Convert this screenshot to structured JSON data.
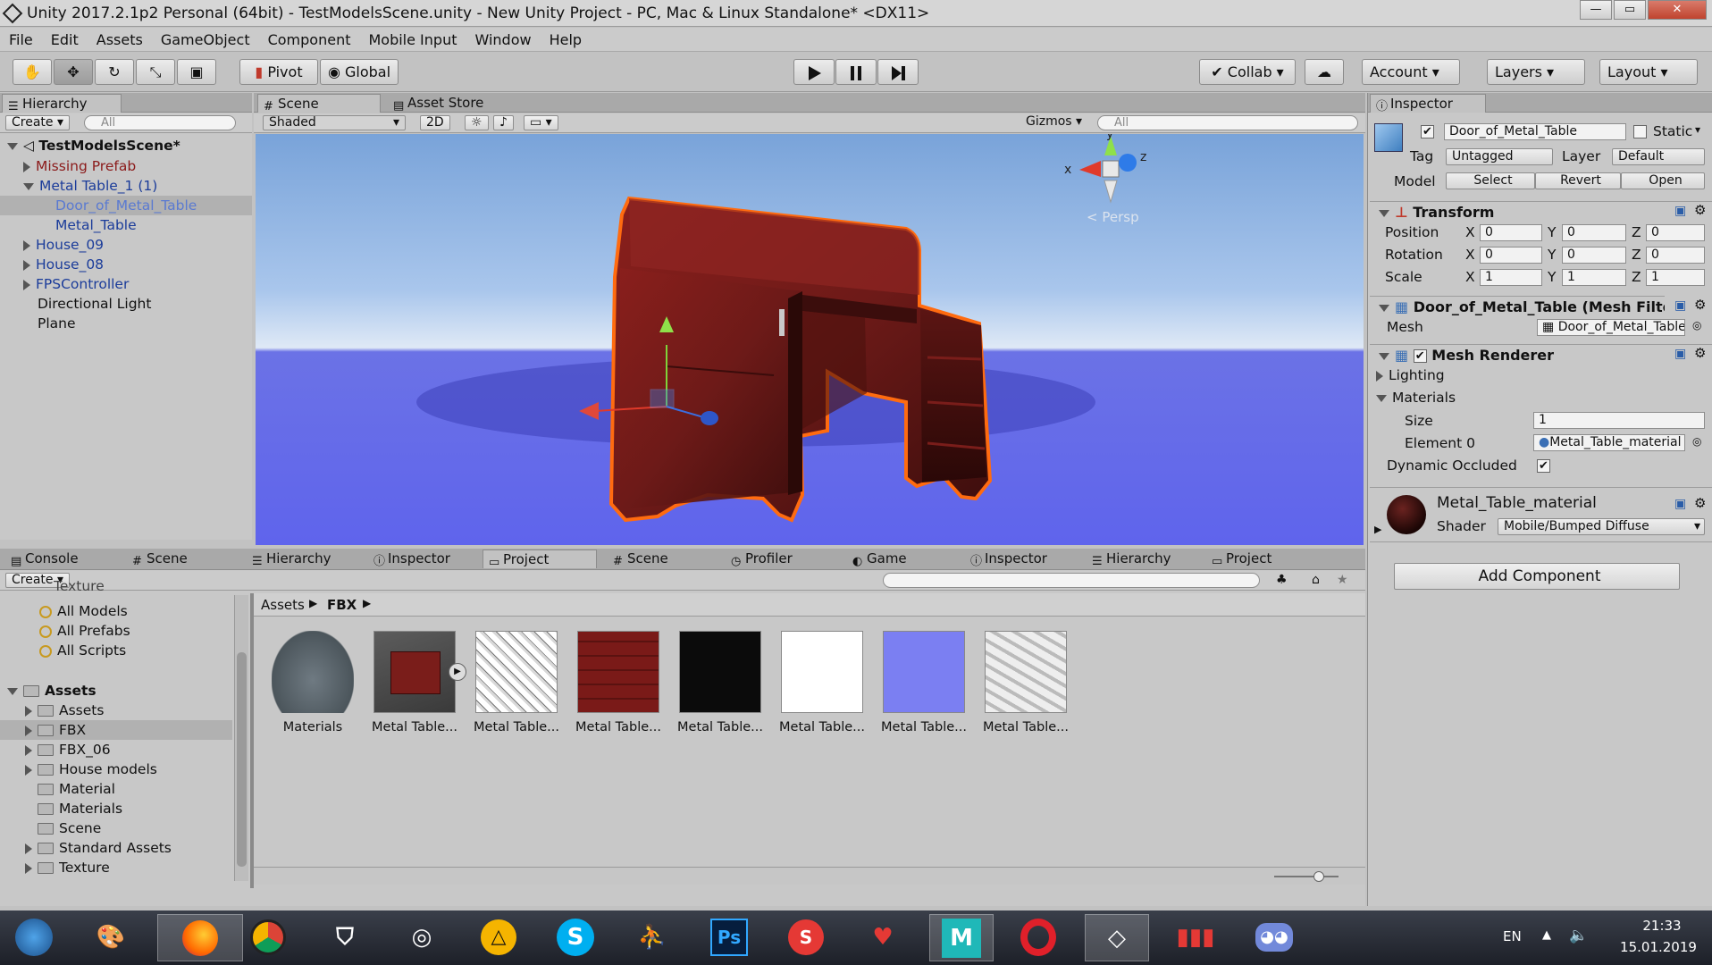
{
  "window": {
    "title": "Unity 2017.2.1p2 Personal (64bit) - TestModelsScene.unity - New Unity Project - PC, Mac & Linux Standalone* <DX11>",
    "minimize": "—",
    "maximize": "▭",
    "close": "✕"
  },
  "menu": [
    "File",
    "Edit",
    "Assets",
    "GameObject",
    "Component",
    "Mobile Input",
    "Window",
    "Help"
  ],
  "toolbar": {
    "pivot": "Pivot",
    "global": "Global",
    "collab": "Collab",
    "account": "Account",
    "layers": "Layers",
    "layout": "Layout"
  },
  "hierarchy": {
    "tab": "Hierarchy",
    "create": "Create",
    "search_placeholder": "All",
    "scene": "TestModelsScene*",
    "items": [
      {
        "label": "Missing Prefab",
        "color": "#8b1a1a"
      },
      {
        "label": "Metal Table_1 (1)",
        "color": "#1b3c9a"
      },
      {
        "label": "Door_of_Metal_Table",
        "color": "#5a7ad1"
      },
      {
        "label": "Metal_Table",
        "color": "#1b3c9a"
      },
      {
        "label": "House_09",
        "color": "#1b3c9a"
      },
      {
        "label": "House_08",
        "color": "#1b3c9a"
      },
      {
        "label": "FPSController",
        "color": "#1b3c9a"
      },
      {
        "label": "Directional Light",
        "color": "#111111"
      },
      {
        "label": "Plane",
        "color": "#111111"
      }
    ]
  },
  "scene": {
    "tab_scene": "Scene",
    "tab_store": "Asset Store",
    "shading": "Shaded",
    "mode2d": "2D",
    "gizmos": "Gizmos",
    "search_placeholder": "All",
    "persp": "Persp",
    "axis_x": "x",
    "axis_y": "y",
    "axis_z": "z"
  },
  "inspector": {
    "tab": "Inspector",
    "object_name": "Door_of_Metal_Table",
    "static": "Static",
    "tag_label": "Tag",
    "tag": "Untagged",
    "layer_label": "Layer",
    "layer": "Default",
    "model_label": "Model",
    "select": "Select",
    "revert": "Revert",
    "open": "Open",
    "transform": {
      "title": "Transform",
      "position": {
        "label": "Position",
        "x": "0",
        "y": "0",
        "z": "0"
      },
      "rotation": {
        "label": "Rotation",
        "x": "0",
        "y": "0",
        "z": "0"
      },
      "scale": {
        "label": "Scale",
        "x": "1",
        "y": "1",
        "z": "1"
      }
    },
    "axis_x": "X",
    "axis_y": "Y",
    "axis_z": "Z",
    "mesh_filter": {
      "title": "Door_of_Metal_Table (Mesh Filter)",
      "mesh_label": "Mesh",
      "mesh": "Door_of_Metal_Table"
    },
    "mesh_renderer": {
      "title": "Mesh Renderer",
      "lighting": "Lighting",
      "materials": "Materials",
      "size_label": "Size",
      "size": "1",
      "element0_label": "Element 0",
      "element0": "Metal_Table_material",
      "dynamic_occluded": "Dynamic Occluded"
    },
    "material": {
      "name": "Metal_Table_material",
      "shader_label": "Shader",
      "shader": "Mobile/Bumped Diffuse"
    },
    "add_component": "Add Component"
  },
  "bottom_tabs": [
    "Console",
    "Scene",
    "Hierarchy",
    "Inspector",
    "Project",
    "Scene",
    "Profiler",
    "Game",
    "Inspector",
    "Hierarchy",
    "Project"
  ],
  "project": {
    "create": "Create",
    "partial_top": "Texture",
    "favorites": [
      "All Models",
      "All Prefabs",
      "All Scripts"
    ],
    "assets_root": "Assets",
    "folders": [
      "Assets",
      "FBX",
      "FBX_06",
      "House models",
      "Material",
      "Materials",
      "Scene",
      "Standard Assets",
      "Texture"
    ],
    "breadcrumb": [
      "Assets",
      "FBX"
    ],
    "files": [
      "Materials",
      "Metal Table...",
      "Metal Table...",
      "Metal Table...",
      "Metal Table...",
      "Metal Table...",
      "Metal Table...",
      "Metal Table..."
    ]
  },
  "taskbar": {
    "lang": "EN",
    "time": "21:33",
    "date": "15.01.2019",
    "apps": [
      "windows-start",
      "paint",
      "firefox",
      "chrome",
      "world-of-tanks",
      "obs",
      "archicad",
      "skype",
      "figure",
      "photoshop",
      "substance",
      "heart-app",
      "maya",
      "opera",
      "unity",
      "equalizer",
      "discord"
    ]
  }
}
